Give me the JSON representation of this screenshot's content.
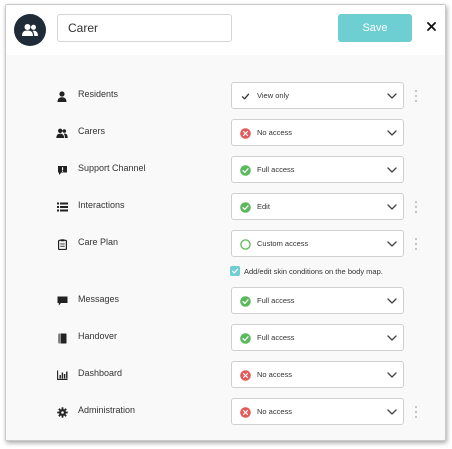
{
  "header": {
    "role_name": "Carer",
    "save_label": "Save",
    "close_glyph": "✕",
    "avatar_icon": "users-icon"
  },
  "colors": {
    "accent": "#6dcfd2",
    "avatar_bg": "#1f2b36",
    "success": "#5cb85c",
    "danger": "#e25a5a",
    "checkmark": "#333333"
  },
  "permissions": [
    {
      "label": "Residents",
      "icon": "person-icon",
      "value": "View only",
      "status": "check",
      "has_menu": true
    },
    {
      "label": "Carers",
      "icon": "users-icon",
      "value": "No access",
      "status": "no-access",
      "has_menu": false
    },
    {
      "label": "Support Channel",
      "icon": "support-chat-icon",
      "value": "Full access",
      "status": "full-access",
      "has_menu": false
    },
    {
      "label": "Interactions",
      "icon": "list-icon",
      "value": "Edit",
      "status": "full-access",
      "has_menu": true
    },
    {
      "label": "Care Plan",
      "icon": "clipboard-icon",
      "value": "Custom access",
      "status": "custom",
      "has_menu": true
    },
    {
      "label": "Messages",
      "icon": "message-icon",
      "value": "Full access",
      "status": "full-access",
      "has_menu": false
    },
    {
      "label": "Handover",
      "icon": "book-icon",
      "value": "Full access",
      "status": "full-access",
      "has_menu": false
    },
    {
      "label": "Dashboard",
      "icon": "bar-chart-icon",
      "value": "No access",
      "status": "no-access",
      "has_menu": false
    },
    {
      "label": "Administration",
      "icon": "gear-icon",
      "value": "No access",
      "status": "no-access",
      "has_menu": true
    }
  ],
  "care_plan_option": {
    "label": "Add/edit skin conditions on the body map.",
    "checked": true
  }
}
